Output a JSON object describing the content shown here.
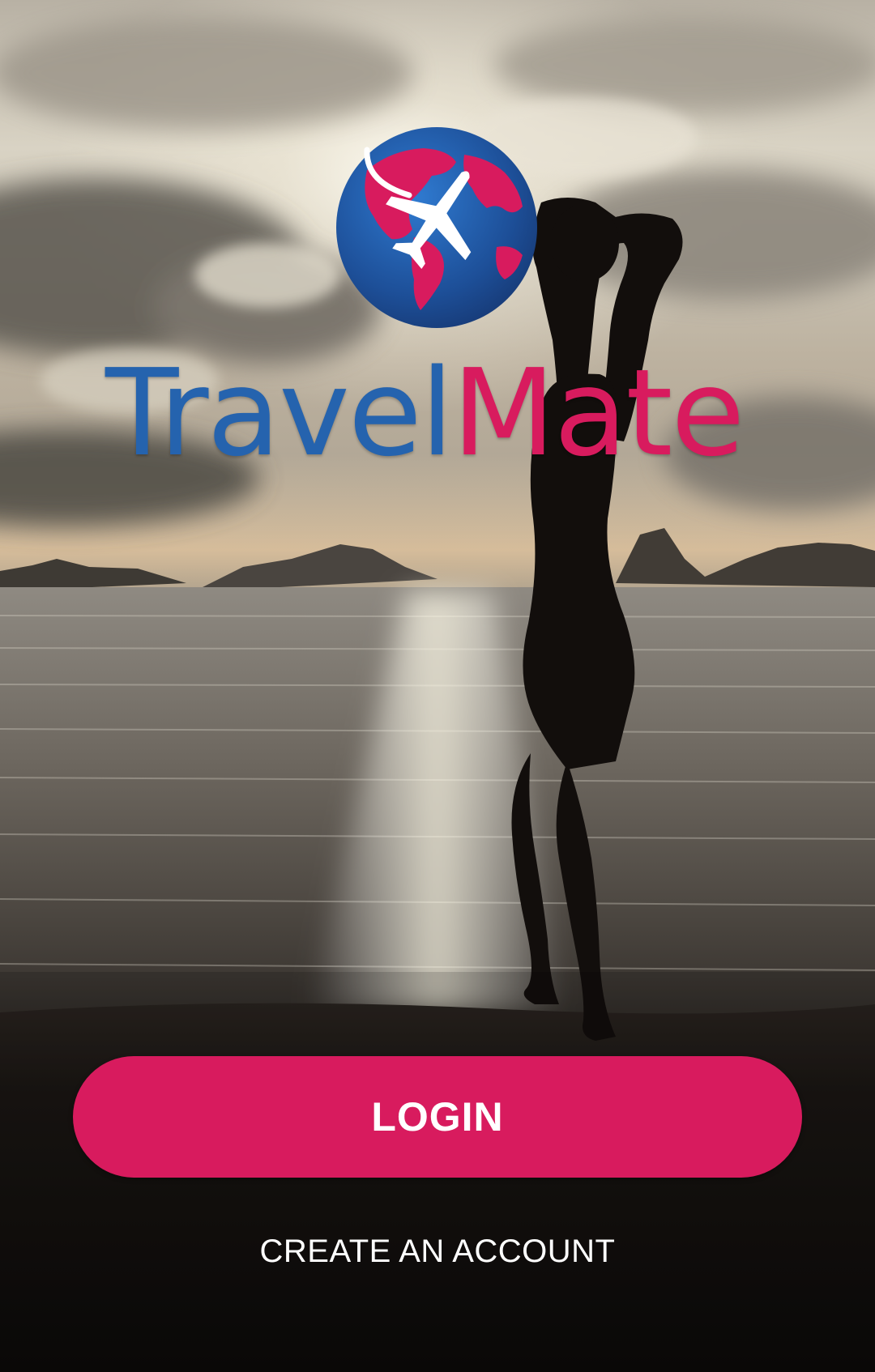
{
  "brand": {
    "name_part1": "Travel",
    "name_part2": "Mate",
    "primary_color": "#2563ae",
    "accent_color": "#d81b5e",
    "logo_icon": "globe-with-airplane-icon"
  },
  "background": {
    "scene": "silhouette-on-beach-at-sunset"
  },
  "actions": {
    "login_label": "LOGIN",
    "create_account_label": "CREATE AN ACCOUNT"
  }
}
